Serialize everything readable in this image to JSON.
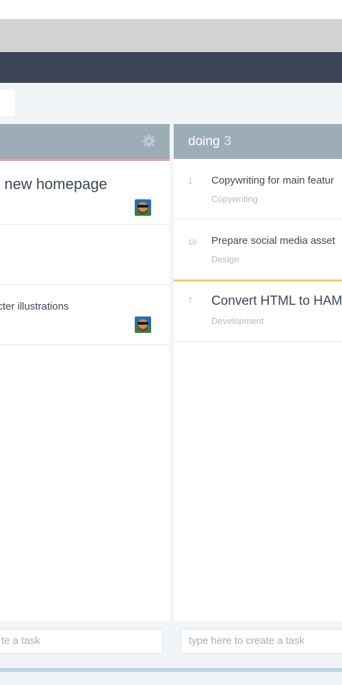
{
  "columns": [
    {
      "id": "left",
      "title": "",
      "count": "",
      "cards": [
        {
          "number": "",
          "title": "a new homepage",
          "tag": "",
          "has_avatar": true
        },
        {
          "number": "",
          "title": "",
          "tag": "",
          "has_avatar": false
        },
        {
          "number": "",
          "title": "acter illustrations",
          "tag": "",
          "has_avatar": true
        }
      ],
      "input_placeholder": "te a task"
    },
    {
      "id": "right",
      "title": "doing",
      "count": "3",
      "cards": [
        {
          "number": "1",
          "title": "Copywriting for main featur",
          "tag": "Copywriting"
        },
        {
          "number": "10",
          "title": "Prepare social media asset",
          "tag": "Design"
        },
        {
          "number": "7",
          "title": "Convert HTML to HAM",
          "tag": "Development"
        }
      ],
      "input_placeholder": "type here to create a task"
    }
  ],
  "colors": {
    "navbar": "#3c4556",
    "column_header": "#9dadb8",
    "board_bg": "#f2f5f8",
    "priority_red": "#e7a3a3",
    "priority_yellow": "#f0cf63"
  }
}
